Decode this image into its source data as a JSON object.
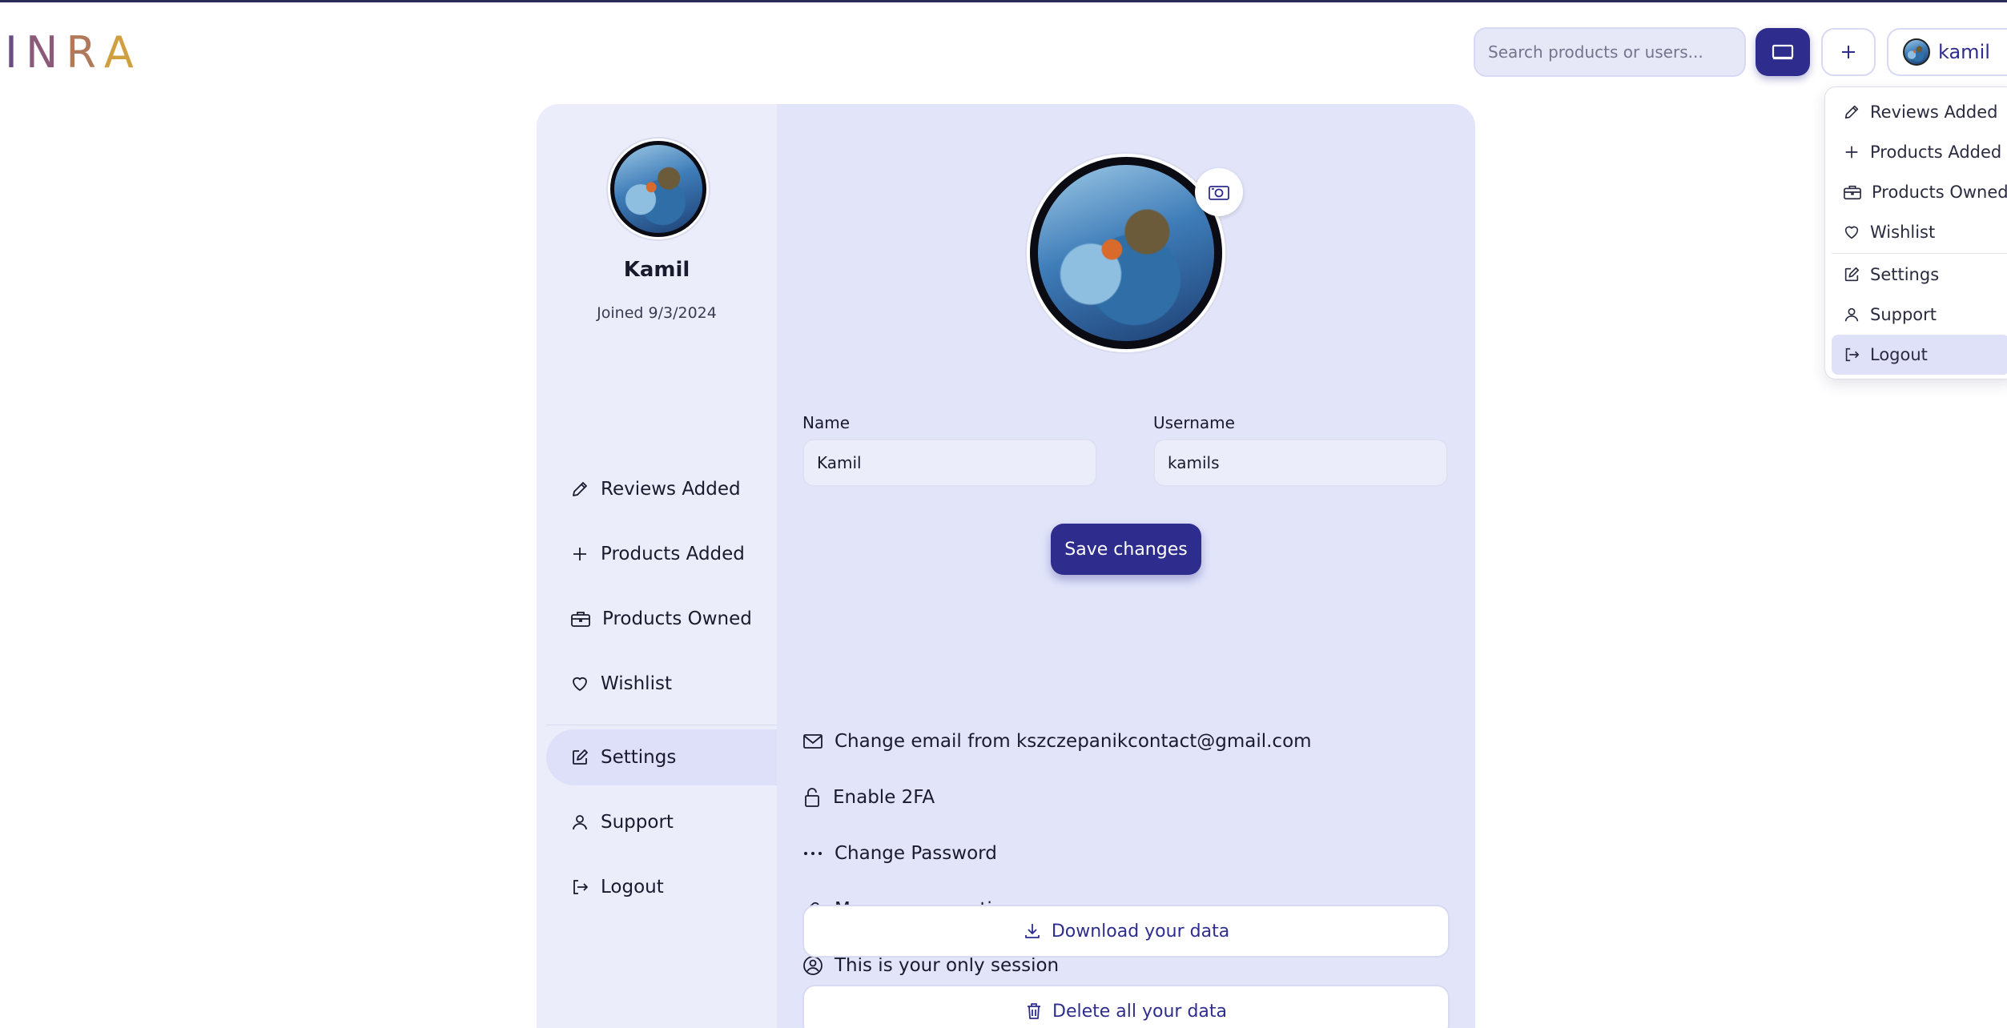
{
  "app": {
    "logo_letters": [
      "I",
      "N",
      "R",
      "A"
    ],
    "logo_colors": [
      "#6b4d86",
      "#8a5a78",
      "#b07a5a",
      "#d0a040"
    ]
  },
  "header": {
    "search_placeholder": "Search products or users...",
    "user_label": "kamil"
  },
  "dropdown": {
    "items": [
      {
        "label": "Reviews Added",
        "icon": "pencil-icon"
      },
      {
        "label": "Products Added",
        "icon": "plus-icon"
      },
      {
        "label": "Products Owned",
        "icon": "briefcase-icon"
      },
      {
        "label": "Wishlist",
        "icon": "heart-icon"
      },
      {
        "label": "Settings",
        "icon": "edit-square-icon"
      },
      {
        "label": "Support",
        "icon": "person-icon"
      },
      {
        "label": "Logout",
        "icon": "logout-icon"
      }
    ]
  },
  "profile": {
    "name": "Kamil",
    "joined": "Joined 9/3/2024"
  },
  "sidebar": {
    "items": [
      {
        "label": "Reviews Added",
        "icon": "pencil-icon"
      },
      {
        "label": "Products Added",
        "icon": "plus-icon"
      },
      {
        "label": "Products Owned",
        "icon": "briefcase-icon"
      },
      {
        "label": "Wishlist",
        "icon": "heart-icon"
      },
      {
        "label": "Settings",
        "icon": "edit-square-icon"
      },
      {
        "label": "Support",
        "icon": "person-icon"
      },
      {
        "label": "Logout",
        "icon": "logout-icon"
      }
    ],
    "active": "Settings"
  },
  "settings": {
    "name_label": "Name",
    "name_value": "Kamil",
    "username_label": "Username",
    "username_value": "kamils",
    "save_label": "Save changes",
    "options": [
      {
        "label": "Change email from kszczepanikcontact@gmail.com",
        "icon": "mail-icon"
      },
      {
        "label": "Enable 2FA",
        "icon": "lock-icon"
      },
      {
        "label": "Change Password",
        "icon": "dots-icon"
      },
      {
        "label": "Manage connections",
        "icon": "link-icon"
      },
      {
        "label": "This is your only session",
        "icon": "user-circle-icon"
      }
    ],
    "download_label": "Download your data",
    "delete_label": "Delete all your data"
  },
  "colors": {
    "accent": "#2e2d8e",
    "card_bg": "#e2e5fa",
    "sidebar_bg": "#ebedfa",
    "active_bg": "#dde0f8"
  }
}
